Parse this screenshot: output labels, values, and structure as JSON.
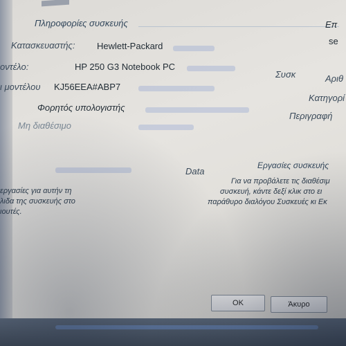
{
  "left_panel": {
    "section_title": "Πληροφορίες συσκευής",
    "rows": [
      {
        "label": "Κατασκευαστής:",
        "value": "Hewlett-Packard"
      },
      {
        "label": "οντέλο:",
        "value": "HP 250 G3 Notebook PC"
      },
      {
        "label": "ι μοντέλου",
        "value": "KJ56EEA#ABP7"
      },
      {
        "label": "",
        "value": "Φορητός υπολογιστής"
      },
      {
        "label": "",
        "value": "Μη διαθέσιμο"
      }
    ],
    "tasks_text_lines": [
      "εργασίες για αυτήν τη",
      "λιδα της συσκευής στο",
      "ιουτές."
    ]
  },
  "right_panel": {
    "top_fragment_1": "Επ",
    "top_fragment_2": "se",
    "labels": [
      {
        "text": "Συσκ",
        "part": "device-label"
      },
      {
        "text": "Αριθ",
        "part": "number-label"
      },
      {
        "text": "Κατηγορί",
        "part": "category-label"
      },
      {
        "text": "Περιγραφή",
        "part": "description-label"
      }
    ],
    "tasks_title": "Εργασίες συσκευής",
    "tasks_body": [
      "Για να προβάλετε τις διαθέσιμ",
      "συσκευή, κάντε δεξί κλικ στο ει",
      "παράθυρο διαλόγου Συσκευές κι Εκ"
    ],
    "overlap_fragment": "Data"
  },
  "buttons": {
    "ok": "OK",
    "cancel": "Άκυρο"
  }
}
